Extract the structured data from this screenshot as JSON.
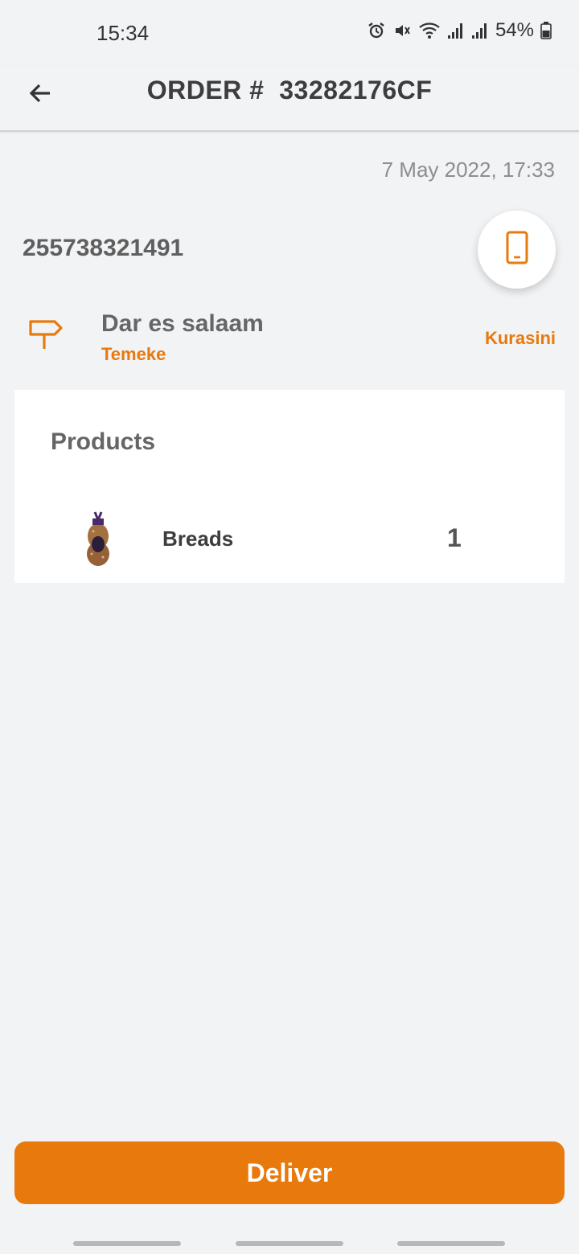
{
  "status_bar": {
    "time": "15:34",
    "battery": "54%",
    "icons": [
      "alarm-icon",
      "mute-icon",
      "wifi-icon",
      "signal-icon",
      "signal-icon",
      "battery-icon"
    ]
  },
  "app_bar": {
    "title": "ORDER #  33282176CF",
    "back_icon": "arrow-back-icon"
  },
  "order": {
    "date": "7 May 2022, 17:33",
    "phone": "255738321491",
    "call_icon": "smartphone-icon",
    "address": {
      "city": "Dar es salaam",
      "district": "Temeke",
      "ward": "Kurasini",
      "icon": "signpost-icon"
    }
  },
  "products": {
    "title": "Products",
    "items": [
      {
        "name": "Breads",
        "quantity": "1"
      }
    ]
  },
  "actions": {
    "deliver_label": "Deliver"
  },
  "colors": {
    "accent": "#e8790c",
    "background": "#f2f3f5",
    "card": "#ffffff"
  }
}
